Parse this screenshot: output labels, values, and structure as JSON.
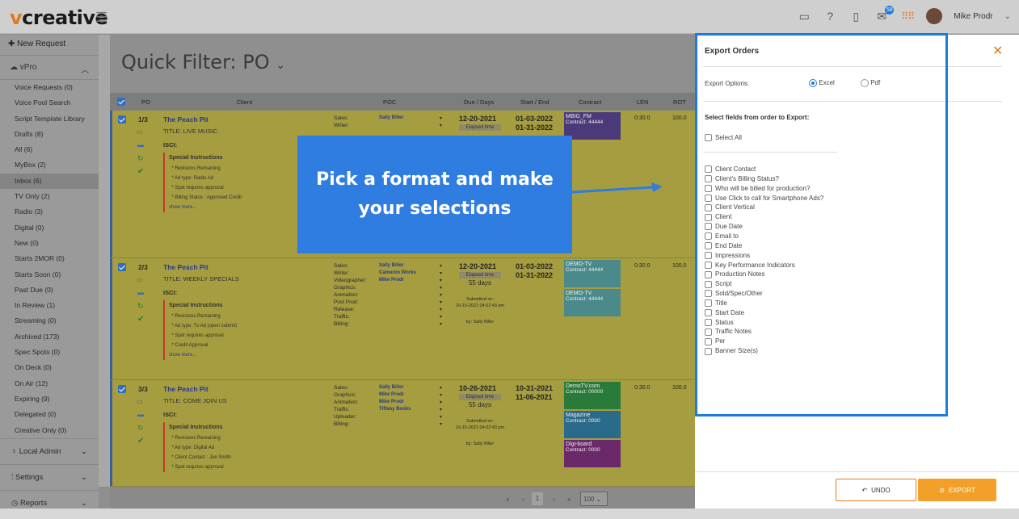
{
  "app": {
    "logo_v": "v",
    "logo_rest": "creative",
    "user_name": "Mike Prodr",
    "notif_count": "58"
  },
  "sidebar": {
    "new_request": "New Request",
    "vpro": "vPro",
    "items": [
      "Voice Requests (0)",
      "Voice Pool Search",
      "Script Template Library",
      "Drafts (8)",
      "All (6)",
      "MyBox (2)",
      "Inbox (6)",
      "TV Only (2)",
      "Radio (3)",
      "Digital (0)",
      "New (0)",
      "Starts 2MOR (0)",
      "Starts Soon (0)",
      "Past Due (0)",
      "In Review (1)",
      "Streaming (0)",
      "Archived (173)",
      "Spec Spots (0)",
      "On Deck (0)",
      "On Air (12)",
      "Expiring (9)",
      "Delegated (0)",
      "Creative Only (0)"
    ],
    "local_admin": "Local Admin",
    "settings": "Settings",
    "reports": "Reports"
  },
  "main": {
    "title": "Quick Filter: PO",
    "headers": {
      "po": "PO",
      "client": "Client",
      "poc": "POC",
      "due": "Due / Days",
      "startend": "Start / End",
      "contract": "Contract",
      "len": "LEN",
      "rot": "ROT"
    },
    "rows": [
      {
        "po": "1/3",
        "client": "The Peach Pit",
        "title": "TITLE: LIVE MUSIC",
        "isci": "ISCI:",
        "instr_title": "Special Instructions",
        "instr": [
          "Revisions Remaining",
          "Ad type: Radio Ad",
          "Spot requires approval",
          "Billing Status : Approved Credit"
        ],
        "show_more": "show more...",
        "poc_labels": [
          "Sales:",
          "Writer:"
        ],
        "poc_names": [
          "Sally Biller"
        ],
        "due": "12-20-2021",
        "elapsed": "Elapsed time",
        "start": "01-03-2022",
        "end": "01-31-2022",
        "contracts": [
          {
            "name": "MBIG_FM",
            "num": "Contract: 44444",
            "color": "#4a3a7a"
          }
        ],
        "len": "0:30.0",
        "rot": "100.0"
      },
      {
        "po": "2/3",
        "client": "The Peach Pit",
        "title": "TITLE: WEEKLY SPECIALS",
        "isci": "ISCI:",
        "instr_title": "Special Instructions",
        "instr": [
          "Revisions Remaining",
          "Ad type: Tv Ad (open submit)",
          "Spot requires approval",
          "Credit Approval"
        ],
        "show_more": "show more...",
        "poc_labels": [
          "Sales:",
          "Writer:",
          "Videographer:",
          "Graphics:",
          "Animation:",
          "Post Prod:",
          "Release:",
          "Traffic:",
          "Billing:"
        ],
        "poc_names": [
          "Sally Biller",
          "Cameron Works",
          "Mike Prodr"
        ],
        "due": "12-20-2021",
        "elapsed": "Elapsed time",
        "days": "55 days",
        "submitted": "Submitted on:",
        "submitted_date": "10-15-2021 04:02:43 pm",
        "by": "by: Sally Biller",
        "start": "01-03-2022",
        "end": "01-31-2022",
        "contracts": [
          {
            "name": "DEMO-TV",
            "num": "Contract: 44444",
            "color": "#4a8a8a"
          },
          {
            "name": "DEMO-TV",
            "num": "Contract: 44444",
            "color": "#4a8a8a"
          }
        ],
        "len": "0:30.0",
        "rot": "100.0"
      },
      {
        "po": "3/3",
        "client": "The Peach Pit",
        "title": "TITLE: COME JOIN US",
        "isci": "ISCI:",
        "instr_title": "Special Instructions",
        "instr": [
          "Revisions Remaining",
          "Ad type: Digital Ad",
          "Client Contact : Joe Smith",
          "Spot requires approval"
        ],
        "poc_labels": [
          "Sales:",
          "Graphics:",
          "Animation:",
          "Traffic:",
          "Uploader:",
          "Billing:"
        ],
        "poc_names": [
          "Sally Biller",
          "Mike Prodr",
          "Mike Prodr",
          "Tiffany Books"
        ],
        "due": "10-26-2021",
        "elapsed": "Elapsed time",
        "days": "55 days",
        "submitted": "Submitted on:",
        "submitted_date": "10-15-2021 04:02:43 pm",
        "by": "by: Sally Biller",
        "start": "10-31-2021",
        "end": "11-06-2021",
        "contracts": [
          {
            "name": "DemoTV.com",
            "num": "Contract: 00000",
            "color": "#2a7a3a"
          },
          {
            "name": "Magazine",
            "num": "Contract: 0000",
            "color": "#2a6a8a"
          },
          {
            "name": "Digi-board",
            "num": "Contract: 0000",
            "color": "#6a2a6a"
          }
        ],
        "len": "0:30.0",
        "rot": "100.0"
      }
    ],
    "pager": {
      "page": "1",
      "per_page": "100"
    }
  },
  "overlay": {
    "line1": "Pick a format and make",
    "line2": "your selections"
  },
  "panel": {
    "title": "Export Orders",
    "options_label": "Export Options:",
    "opt_excel": "Excel",
    "opt_pdf": "Pdf",
    "select_label": "Select fields from order to Export:",
    "select_all": "Select All",
    "fields": [
      "Client Contact",
      "Client's Billing Status?",
      "Who will be billed for production?",
      "Use Click to call for Smartphone Ads?",
      "Client Vertical",
      "Client",
      "Due Date",
      "Email to",
      "End Date",
      "Impressions",
      "Key Performance Indicators",
      "Production Notes",
      "Script",
      "Sold/Spec/Other",
      "Title",
      "Start Date",
      "Status",
      "Traffic Notes",
      "Per",
      "Banner Size(s)"
    ],
    "undo": "UNDO",
    "export": "EXPORT"
  }
}
